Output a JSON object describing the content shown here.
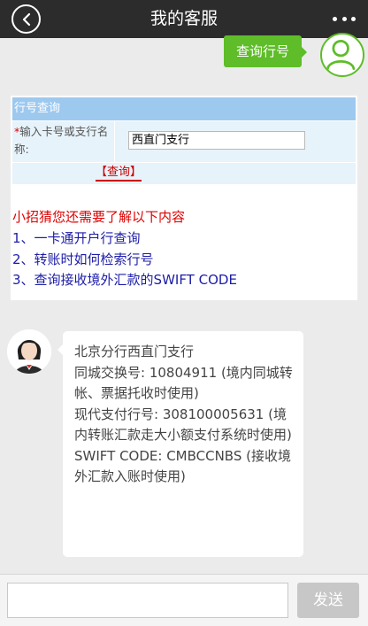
{
  "header": {
    "title": "我的客服"
  },
  "user_message": {
    "text": "查询行号"
  },
  "query_panel": {
    "header": "行号查询",
    "required_mark": "*",
    "field_label": "输入卡号或支行名称:",
    "field_value": "西直门支行",
    "query_button": "【查询】",
    "suggest_title": "小招猜您还需要了解以下内容",
    "faq": [
      {
        "text": "1、一卡通开户行查询"
      },
      {
        "text": "2、转账时如何检索行号"
      },
      {
        "text": "3、查询接收境外汇款的SWIFT CODE"
      }
    ]
  },
  "bot_message": {
    "line1": "北京分行西直门支行",
    "line2": "同城交换号: 10804911 (境内同城转帐、票据托收时使用)",
    "line3": "现代支付行号: 308100005631 (境内转账汇款走大小额支付系统时使用)",
    "line4": "SWIFT CODE: CMBCCNBS (接收境外汇款入账时使用)"
  },
  "composer": {
    "input_value": "",
    "send_label": "发送"
  },
  "icons": {
    "back": "back-arrow-icon",
    "more": "more-dots-icon",
    "user": "user-avatar-icon",
    "bot": "agent-avatar-icon"
  },
  "colors": {
    "accent_green": "#5ebd28",
    "link_blue": "#1c1ca8",
    "alert_red": "#e00000",
    "panel_blue": "#9ec9ef"
  }
}
